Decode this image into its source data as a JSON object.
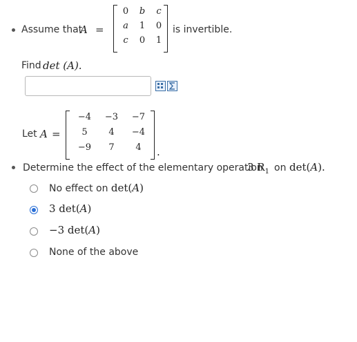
{
  "question1": {
    "prefix": "Assume that",
    "var": "A",
    "eq": "=",
    "matrix": [
      [
        "0",
        "b",
        "c"
      ],
      [
        "a",
        "1",
        "0"
      ],
      [
        "c",
        "0",
        "1"
      ]
    ],
    "matrix_italic": [
      [
        false,
        true,
        true
      ],
      [
        true,
        false,
        false
      ],
      [
        true,
        false,
        false
      ]
    ],
    "suffix": "is invertible.",
    "find_prefix": "Find",
    "find_expr": "det (A)."
  },
  "question2": {
    "let_prefix": "Let",
    "var": "A",
    "eq": "=",
    "matrix": [
      [
        "−4",
        "−3",
        "−7"
      ],
      [
        "5",
        "4",
        "−4"
      ],
      [
        "−9",
        "7",
        "4"
      ]
    ],
    "matrix_suffix": ".",
    "prompt_prefix": "Determine the effect of the elementary operation",
    "prompt_op": "3 R",
    "prompt_op_sub": "1",
    "prompt_on": "on",
    "prompt_expr": "det(A).",
    "options": [
      {
        "text": "No effect on",
        "math": "det(A)",
        "selected": false
      },
      {
        "text": "",
        "math": "3 det(A)",
        "selected": true
      },
      {
        "text": "",
        "math": "−3 det(A)",
        "selected": false
      },
      {
        "text": "None of the above",
        "math": "",
        "selected": false
      }
    ]
  },
  "icons": [
    "matrix-tool-icon",
    "formula-tool-icon"
  ],
  "colors": {
    "accent": "#2a6fd6",
    "text": "#333333"
  }
}
